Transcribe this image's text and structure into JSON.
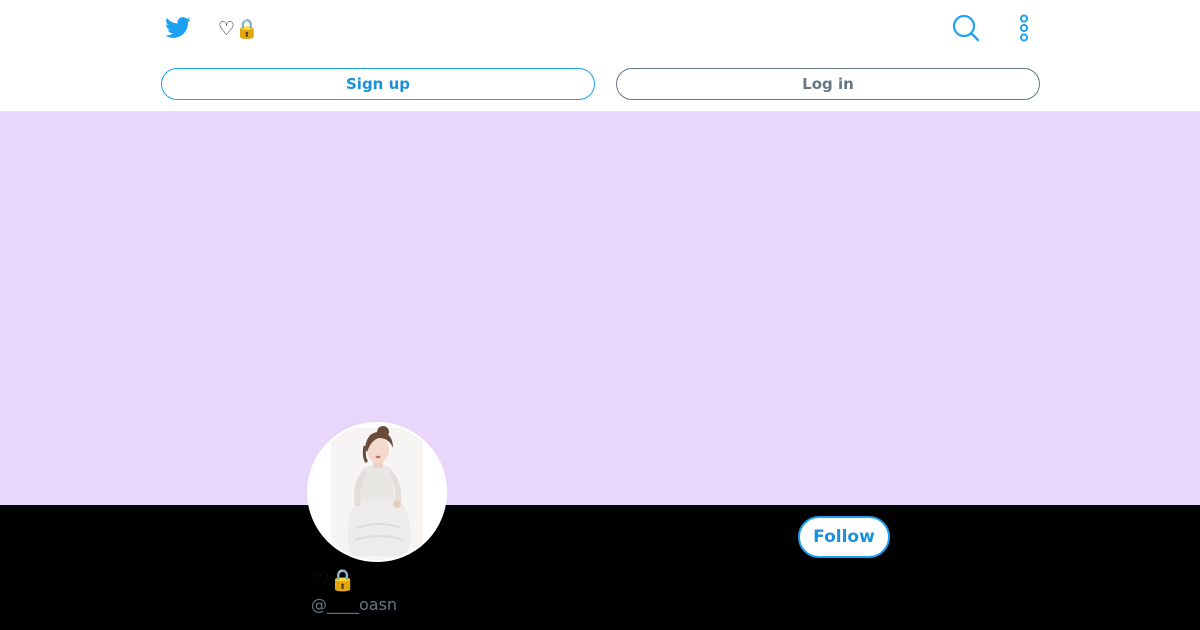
{
  "header": {
    "logo_icon": "twitter-bird-icon",
    "display_name": "♡🔒",
    "search_icon": "search-icon",
    "more_icon": "vertical-ellipsis-icon",
    "signup_label": "Sign up",
    "login_label": "Log in"
  },
  "profile": {
    "banner_color": "#e8d7fa",
    "avatar_icon": "profile-photo",
    "display_name": "♡🔒",
    "handle": "@____oasn",
    "follow_label": "Follow"
  },
  "colors": {
    "accent": "#1da1f2",
    "page_background": "#000000",
    "secondary_text": "#657786"
  }
}
